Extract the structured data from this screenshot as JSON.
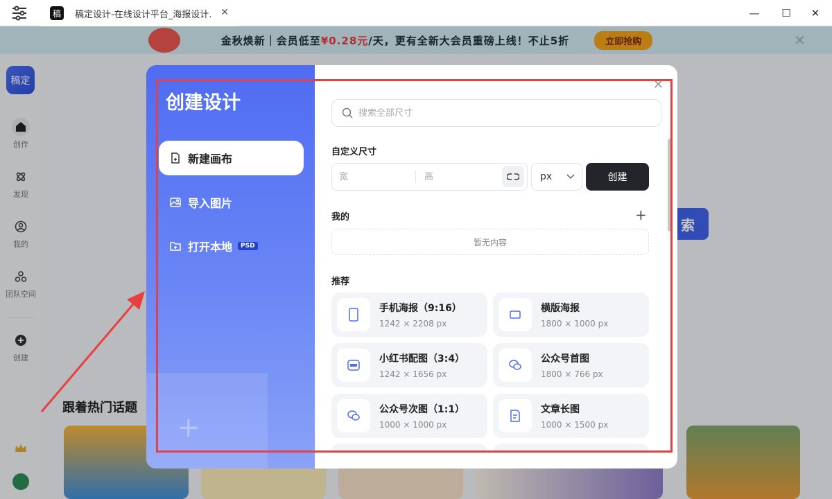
{
  "window": {
    "tab_logo": "稿",
    "tab_title": "稿定设计-在线设计平台_海报设计…",
    "min_label": "—",
    "max_label": "☐",
    "close_label": "✕"
  },
  "banner": {
    "text_before": "金秋焕新｜会员低至",
    "price": "¥0.28元",
    "text_after": "/天，更有全新大会员重磅上线！不止5折",
    "button": "立即抢购"
  },
  "sidebar": {
    "logo": "稿定",
    "items": [
      {
        "label": "创作",
        "icon": "home-icon"
      },
      {
        "label": "发现",
        "icon": "discover-icon"
      },
      {
        "label": "我的",
        "icon": "user-icon"
      },
      {
        "label": "团队空间",
        "icon": "team-icon"
      },
      {
        "label": "创建",
        "icon": "plus-circle-icon"
      }
    ]
  },
  "background": {
    "search_button": "索",
    "section_heading": "跟着热门话题"
  },
  "modal": {
    "title": "创建设计",
    "left_items": [
      {
        "label": "新建画布",
        "icon": "new-canvas-icon",
        "active": true
      },
      {
        "label": "导入图片",
        "icon": "import-image-icon",
        "active": false
      },
      {
        "label": "打开本地",
        "icon": "open-folder-icon",
        "active": false,
        "badge": "PSD"
      }
    ],
    "search_placeholder": "搜索全部尺寸",
    "custom_size_label": "自定义尺寸",
    "width_placeholder": "宽",
    "height_placeholder": "高",
    "unit": "px",
    "create_button": "创建",
    "mine_label": "我的",
    "mine_add": "+",
    "empty_text": "暂无内容",
    "recommend_label": "推荐",
    "recommend": [
      {
        "name": "手机海报（9:16）",
        "size": "1242 × 2208 px",
        "icon": "phone-icon"
      },
      {
        "name": "横版海报",
        "size": "1800 × 1000 px",
        "icon": "landscape-icon"
      },
      {
        "name": "小红书配图（3:4）",
        "size": "1242 × 1656 px",
        "icon": "xiaohongshu-icon"
      },
      {
        "name": "公众号首图",
        "size": "1800 × 766 px",
        "icon": "wechat-icon"
      },
      {
        "name": "公众号次图（1:1）",
        "size": "1000 × 1000 px",
        "icon": "wechat-icon"
      },
      {
        "name": "文章长图",
        "size": "1000 × 1500 px",
        "icon": "document-icon"
      }
    ]
  },
  "colors": {
    "accent": "#4f6cf3",
    "annotation": "#e8403e",
    "create_button_bg": "#23252a"
  }
}
